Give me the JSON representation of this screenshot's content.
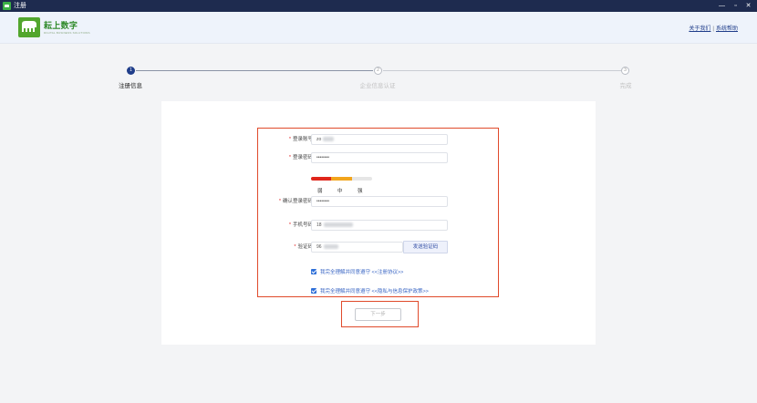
{
  "window": {
    "title": "注册",
    "minimize_glyph": "—",
    "maximize_glyph": "▫",
    "close_glyph": "✕"
  },
  "header": {
    "logo_text": "耘上数字",
    "logo_subtext": "DIGITAL BUSINESS SOLUTIONS",
    "links": {
      "about": "关于我们",
      "separator": "|",
      "help": "系统帮助"
    }
  },
  "steps": [
    {
      "number": "1",
      "label": "注册信息",
      "state": "active"
    },
    {
      "number": "2",
      "label": "企业信息认证",
      "state": "idle"
    },
    {
      "number": "3",
      "label": "完成",
      "state": "idle"
    }
  ],
  "form": {
    "account": {
      "label": "登录账号",
      "value": "zo"
    },
    "password": {
      "label": "登录密码",
      "value": "••••••••"
    },
    "strength": {
      "weak": "弱",
      "medium": "中",
      "strong": "强",
      "level_fraction": 0.67
    },
    "confirm_password": {
      "label": "确认登录密码",
      "value": "••••••••"
    },
    "phone": {
      "label": "手机号码",
      "value": "18"
    },
    "code": {
      "label": "验证码",
      "value": "96",
      "send_button": "发送验证码"
    },
    "agreements": [
      {
        "text": "我完全理解并同意遵守 <<注册协议>>",
        "checked": true
      },
      {
        "text": "我完全理解并同意遵守 <<隐私与信息保护政策>>",
        "checked": true
      }
    ],
    "next_button": "下一步"
  },
  "colors": {
    "titlebar": "#1e2b4f",
    "brand_green": "#52a62e",
    "accent_blue": "#1f3d8a",
    "highlight_red": "#e04a2b",
    "strength_weak": "#e0261b",
    "strength_medium": "#f2a51c"
  },
  "icons": {
    "app": "app-icon",
    "logo": "elephant-logo-icon",
    "checkbox": "checkbox-checked-icon"
  }
}
